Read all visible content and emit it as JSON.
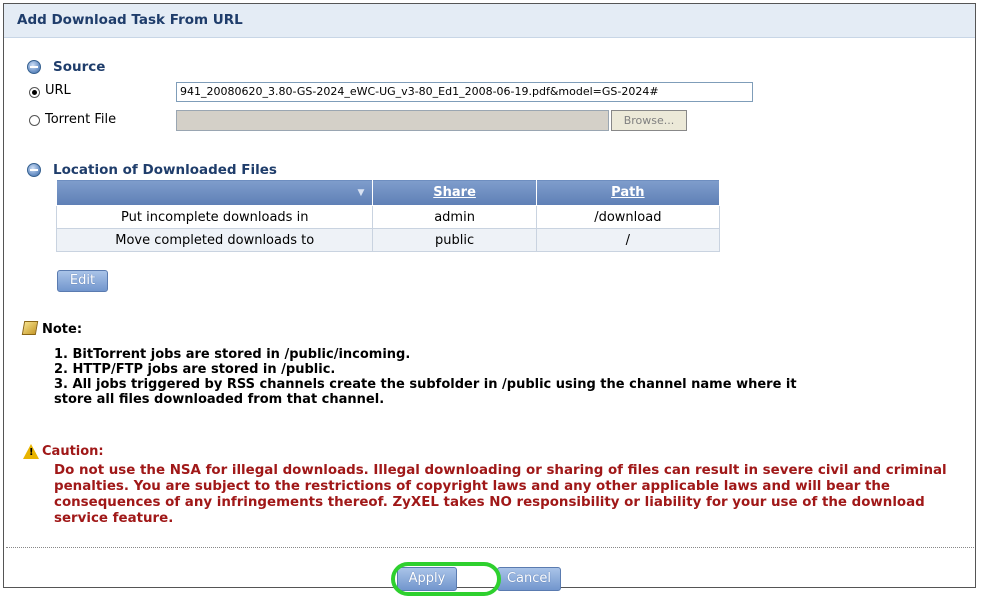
{
  "panel": {
    "title": "Add Download Task From URL"
  },
  "source": {
    "title": "Source",
    "url_label": "URL",
    "url_value": "941_20080620_3.80-GS-2024_eWC-UG_v3-80_Ed1_2008-06-19.pdf&model=GS-2024#",
    "torrent_label": "Torrent File",
    "browse_label": "Browse..."
  },
  "location": {
    "title": "Location of Downloaded Files",
    "columns": [
      "",
      "Share",
      "Path"
    ],
    "rows": [
      {
        "label": "Put incomplete downloads in",
        "share": "admin",
        "path": "/download"
      },
      {
        "label": "Move completed downloads to",
        "share": "public",
        "path": "/"
      }
    ],
    "edit_label": "Edit"
  },
  "note": {
    "title": "Note:",
    "lines": [
      "1. BitTorrent jobs are stored in /public/incoming.",
      "2. HTTP/FTP jobs are stored in /public.",
      "3. All jobs triggered by RSS channels create the subfolder in /public using the channel name where it",
      "store all files downloaded from that channel."
    ]
  },
  "caution": {
    "title": "Caution:",
    "text": "Do not use the NSA for illegal downloads. Illegal downloading or sharing of files can result in severe civil and criminal penalties. You are subject to the restrictions of copyright laws and any other applicable laws and will bear the consequences of any infringements thereof. ZyXEL takes NO responsibility or liability for your use of the download service feature."
  },
  "actions": {
    "apply": "Apply",
    "cancel": "Cancel"
  },
  "colors": {
    "title": "#1f3d6b",
    "caution": "#a01818",
    "highlight": "#2ed02e",
    "header": "#6e8fc3"
  }
}
